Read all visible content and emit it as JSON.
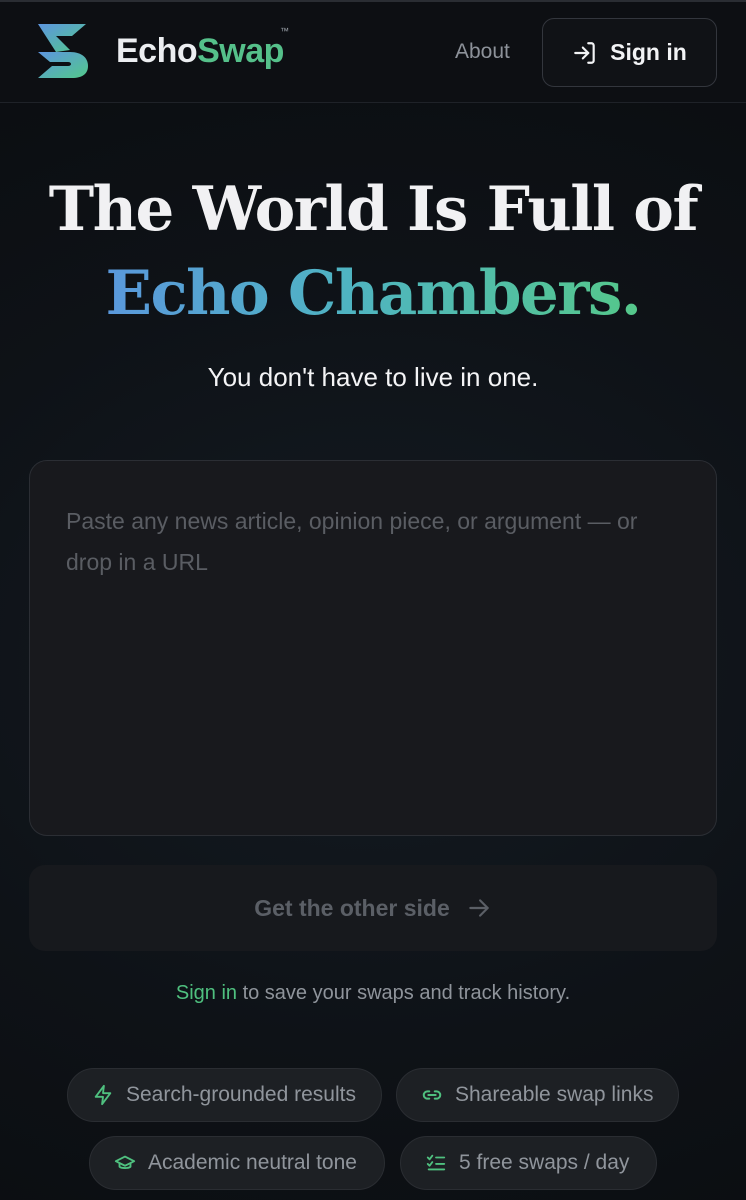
{
  "header": {
    "brand_part1": "Echo",
    "brand_part2": "Swap",
    "trademark": "™",
    "about_label": "About",
    "signin_label": "Sign in"
  },
  "hero": {
    "title_line1": "The World Is Full of",
    "title_line2": "Echo Chambers.",
    "subtitle": "You don't have to live in one."
  },
  "input": {
    "value": "",
    "placeholder": "Paste any news article, opinion piece, or argument — or drop in a URL"
  },
  "cta": {
    "label": "Get the other side",
    "icon": "arrow-right-icon"
  },
  "signin_note": {
    "link_text": "Sign in",
    "rest_text": " to save your swaps and track history."
  },
  "features": [
    {
      "label": "Search-grounded results",
      "icon": "lightning-icon"
    },
    {
      "label": "Shareable swap links",
      "icon": "link-icon"
    },
    {
      "label": "Academic neutral tone",
      "icon": "graduation-cap-icon"
    },
    {
      "label": "5 free swaps / day",
      "icon": "checklist-icon"
    }
  ],
  "colors": {
    "background": "#0c0e12",
    "accent_green": "#4fc07f",
    "accent_blue": "#5a98dc",
    "card": "#18191d"
  }
}
